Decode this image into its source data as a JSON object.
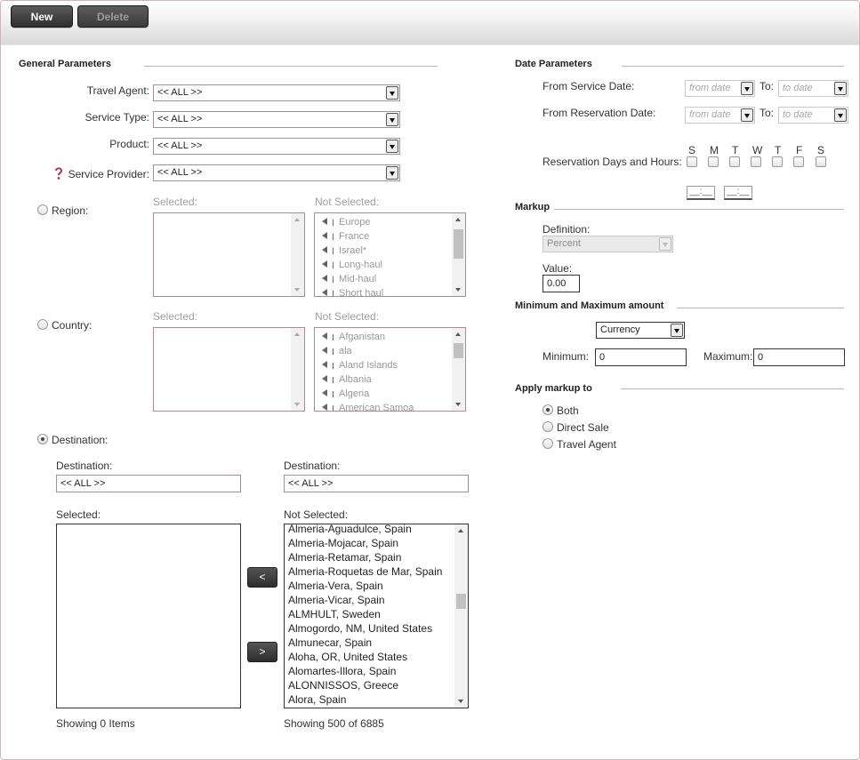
{
  "toolbar": {
    "new_label": "New",
    "delete_label": "Delete"
  },
  "general": {
    "title": "General Parameters",
    "travel_agent_label": "Travel Agent:",
    "travel_agent_value": "<< ALL >>",
    "service_type_label": "Service Type:",
    "service_type_value": "<< ALL >>",
    "product_label": "Product:",
    "product_value": "<< ALL >>",
    "service_provider_label": "Service Provider:",
    "service_provider_value": "<< ALL >>",
    "region": {
      "label": "Region:",
      "selected_label": "Selected:",
      "not_selected_label": "Not Selected:",
      "not_selected_items": [
        "Europe",
        "France",
        "Israel*",
        "Long-haul",
        "Mid-haul",
        "Short haul"
      ]
    },
    "country": {
      "label": "Country:",
      "selected_label": "Selected:",
      "not_selected_label": "Not Selected:",
      "not_selected_items": [
        "Afganistan",
        "ala",
        "Aland Islands",
        "Albania",
        "Algeria",
        "American Samoa"
      ]
    },
    "destination": {
      "label": "Destination:",
      "filter_left_label": "Destination:",
      "filter_left_value": "<< ALL >>",
      "filter_right_label": "Destination:",
      "filter_right_value": "<< ALL >>",
      "selected_label": "Selected:",
      "not_selected_label": "Not Selected:",
      "move_left_label": "<",
      "move_right_label": ">",
      "not_selected_items": [
        "Almeria-Aguadulce, Spain",
        "Almeria-Mojacar, Spain",
        "Almeria-Retamar, Spain",
        "Almeria-Roquetas de Mar, Spain",
        "Almeria-Vera, Spain",
        "Almeria-Vicar, Spain",
        "ALMHULT, Sweden",
        "Almogordo, NM, United States",
        "Almunecar, Spain",
        "Aloha, OR, United States",
        "Alomartes-Illora, Spain",
        "ALONNISSOS, Greece",
        "Alora, Spain"
      ],
      "selected_count_text": "Showing 0 Items",
      "not_selected_count_text": "Showing 500 of 6885"
    }
  },
  "dates": {
    "title": "Date Parameters",
    "from_service_label": "From Service Date:",
    "from_service_placeholder": "from date",
    "to_label": "To:",
    "to_service_placeholder": "to date",
    "from_reservation_label": "From Reservation Date:",
    "from_reservation_placeholder": "from date",
    "to_reservation_placeholder": "to date",
    "days_label": "Reservation Days and Hours:",
    "days": [
      "S",
      "M",
      "T",
      "W",
      "T",
      "F",
      "S"
    ],
    "time_from": "__:__",
    "time_to": "__:__"
  },
  "markup": {
    "title": "Markup",
    "definition_label": "Definition:",
    "definition_value": "Percent",
    "value_label": "Value:",
    "value_value": "0.00"
  },
  "minmax": {
    "title": "Minimum and Maximum amount",
    "currency_value": "Currency",
    "minimum_label": "Minimum:",
    "minimum_value": "0",
    "maximum_label": "Maximum:",
    "maximum_value": "0"
  },
  "apply": {
    "title": "Apply markup to",
    "options": [
      "Both",
      "Direct Sale",
      "Travel Agent"
    ],
    "selected": "Both"
  }
}
